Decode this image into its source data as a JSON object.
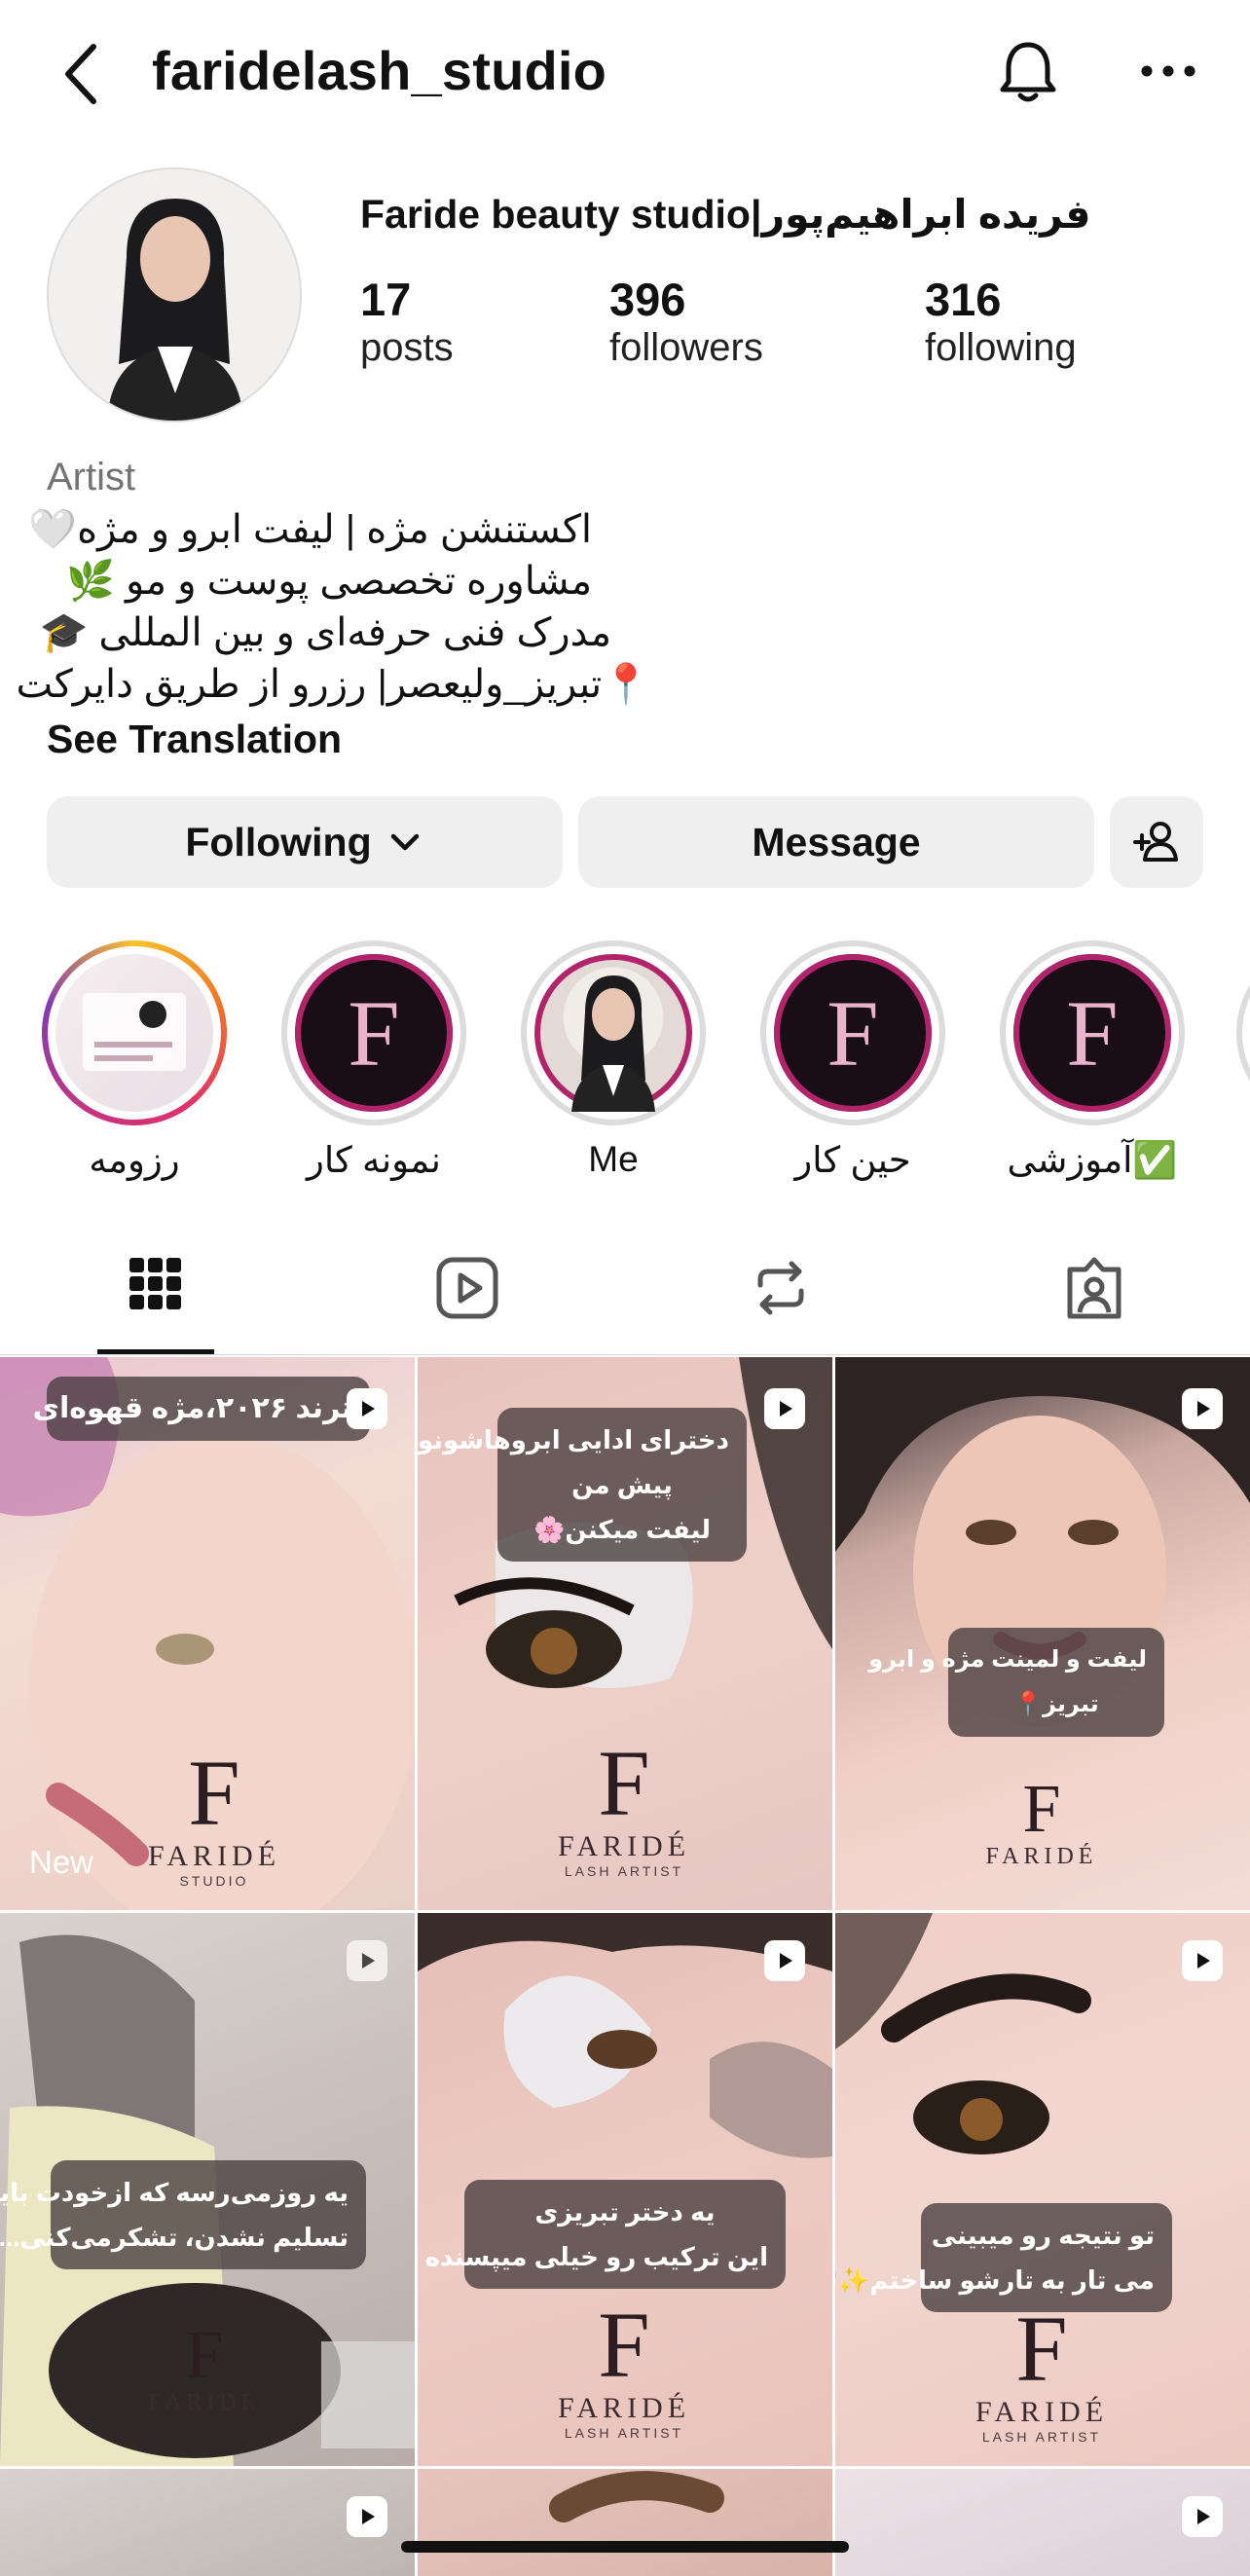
{
  "header": {
    "username": "faridelash_studio",
    "back_icon": "chevron-left-icon",
    "bell_icon": "bell-icon",
    "more_icon": "more-horizontal-icon"
  },
  "profile": {
    "display_name": "Faride beauty studio|فریده ابراهیم‌پور",
    "stats": [
      {
        "value": "17",
        "label": "posts"
      },
      {
        "value": "396",
        "label": "followers"
      },
      {
        "value": "316",
        "label": "following"
      }
    ],
    "category": "Artist",
    "bio_lines": [
      "اکستنشن مژه | لیفت ابرو و مژه🤍",
      "مشاوره تخصصی پوست و مو 🌿",
      "مدرک فنی حرفه‌ای و بین المللی 🎓",
      "📍تبریز_ولیعصر| رزرو از طریق دایرکت"
    ],
    "see_translation": "See Translation"
  },
  "actions": {
    "following_label": "Following",
    "message_label": "Message",
    "add_person_icon": "person-add-icon"
  },
  "highlights": [
    {
      "label": "رزومه"
    },
    {
      "label": "نمونه کار"
    },
    {
      "label": "Me"
    },
    {
      "label": "حین کار"
    },
    {
      "label": "آموزشی✅"
    }
  ],
  "tabs": [
    {
      "name": "grid",
      "icon": "grid-icon",
      "selected": true
    },
    {
      "name": "reels",
      "icon": "reels-icon",
      "selected": false
    },
    {
      "name": "reposts",
      "icon": "repost-icon",
      "selected": false
    },
    {
      "name": "tagged",
      "icon": "tagged-person-icon",
      "selected": false
    }
  ],
  "grid": {
    "posts": [
      {
        "caption": "ترند ۲۰۲۶،مژه قهوه‌ای",
        "badge": "New",
        "logo": "FARIDÉ"
      },
      {
        "caption": "دخترای ادایی ابروهاشونو\nپیش من\nلیفت میکنن🌸",
        "logo": "FARIDÉ"
      },
      {
        "caption": "لیفت و لمینت مژه و ابرو\nتبریز📍",
        "logo": "FARIDÉ"
      },
      {
        "caption": "یه روزمی‌رسه که ازخودت بایت\nتسلیم نشدن، تشکرمی‌کنی...🤍",
        "logo": "FARIDÉ"
      },
      {
        "caption": "یه دختر تبریزی\nاین ترکیب رو خیلی میپسنده ✨🤍",
        "logo": "FARIDÉ"
      },
      {
        "caption": "تو نتیجه رو میبینی\nمی تار به تارشو ساختم✨🤍",
        "logo": "FARIDÉ"
      }
    ],
    "logo_sub": "STUDIO",
    "logo_sub2": "LASH ARTIST"
  },
  "colors": {
    "accent_ring": "#e1306c",
    "button_bg": "#efefef"
  }
}
